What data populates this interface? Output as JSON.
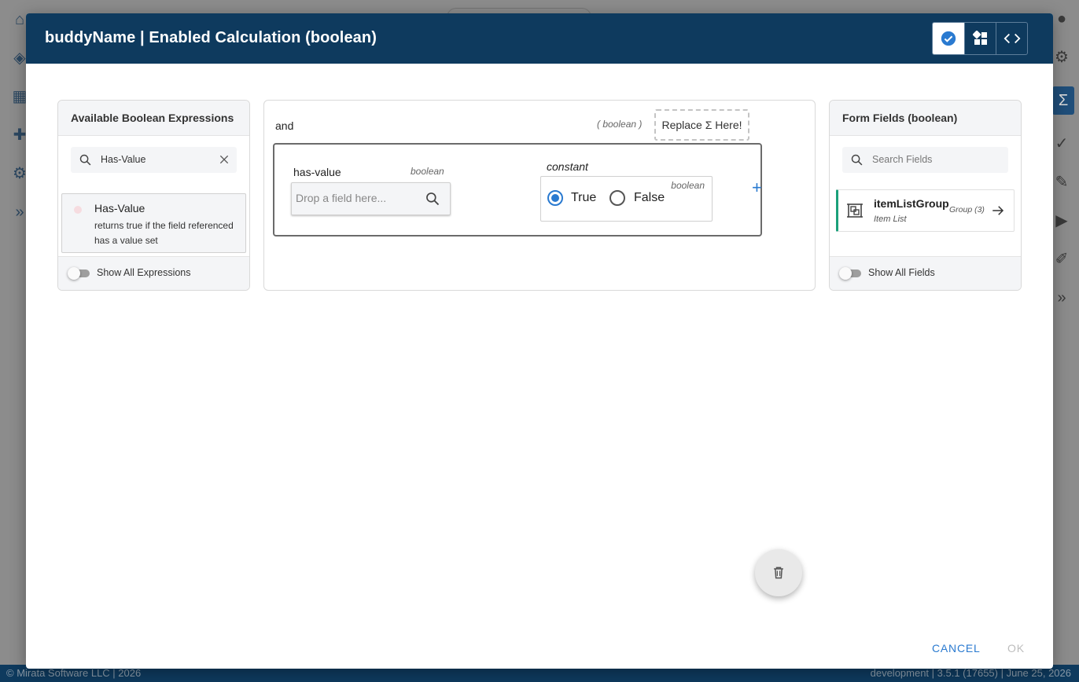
{
  "background": {
    "footer_left": "© Mirata Software LLC | 2026",
    "footer_right": "development | 3.5.1 (17655) | June 25, 2026"
  },
  "modal": {
    "title": "buddyName | Enabled Calculation (boolean)",
    "tools": [
      {
        "icon": "check-circle-icon",
        "active": true
      },
      {
        "icon": "dashboard-icon",
        "active": false
      },
      {
        "icon": "code-icon",
        "active": false
      }
    ],
    "cancel_label": "CANCEL",
    "ok_label": "OK"
  },
  "left_panel": {
    "title": "Available Boolean Expressions",
    "search_value": "Has-Value",
    "expressions": [
      {
        "name": "Has-Value",
        "description": "returns true if the field referenced has a value set"
      }
    ],
    "toggle_label": "Show All Expressions"
  },
  "center_panel": {
    "operator": "and",
    "operator_type": "( boolean )",
    "replace_label": "Replace Σ Here!",
    "has_value": {
      "label": "has-value",
      "type": "boolean",
      "placeholder": "Drop a field here..."
    },
    "constant": {
      "label": "constant",
      "type": "boolean",
      "options": [
        "True",
        "False"
      ],
      "selected": "True"
    },
    "add_symbol": "+"
  },
  "right_panel": {
    "title": "Form Fields (boolean)",
    "search_placeholder": "Search Fields",
    "fields": [
      {
        "name": "itemListGroup",
        "subtitle": "Item List",
        "meta": "Group (3)"
      }
    ],
    "toggle_label": "Show All Fields"
  },
  "colors": {
    "header_bg": "#0e3a5e",
    "accent": "#2a7ad0",
    "field_border": "#1aa07a"
  }
}
